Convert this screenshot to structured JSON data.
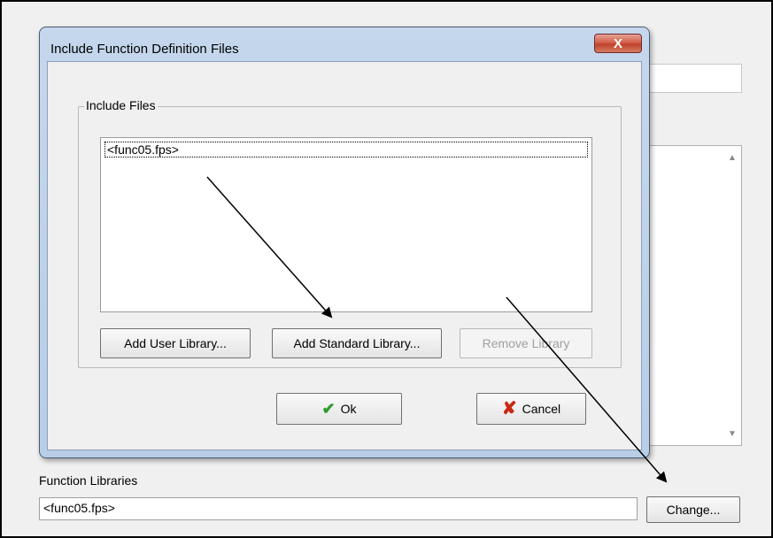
{
  "background": {
    "function_libraries_label": "Function Libraries",
    "function_libraries_value": "<func05.fps>",
    "change_button": "Change..."
  },
  "dialog": {
    "title": "Include Function Definition Files",
    "close_glyph": "X",
    "group_label": "Include Files",
    "list_items": [
      "<func05.fps>"
    ],
    "add_user_library": "Add User Library...",
    "add_standard_library": "Add Standard Library...",
    "remove_library": "Remove Library",
    "ok_label": "Ok",
    "cancel_label": "Cancel"
  },
  "colors": {
    "check_icon": "#2e9b2e",
    "cancel_icon": "#c82a15",
    "title_bar": "#c5d7ec"
  }
}
